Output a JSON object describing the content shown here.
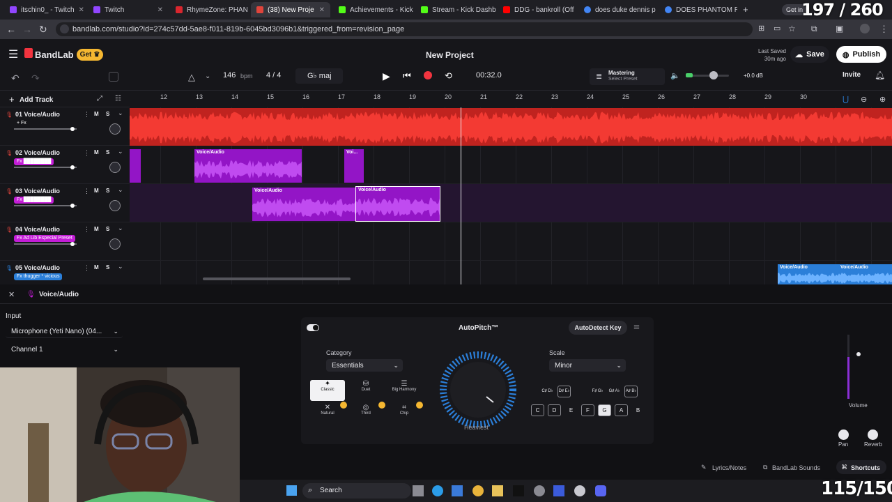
{
  "browser": {
    "tabs": [
      {
        "label": "itschin0_ - Twitch",
        "color": "#9146ff"
      },
      {
        "label": "Twitch",
        "color": "#9146ff"
      },
      {
        "label": "RhymeZone: PHAN",
        "color": "#d9262e"
      },
      {
        "label": "(38) New Proje",
        "color": "#e0443b"
      },
      {
        "label": "Achievements - Kick",
        "color": "#53fc18"
      },
      {
        "label": "Stream - Kick Dashb",
        "color": "#53fc18"
      },
      {
        "label": "DDG - bankroll (Off",
        "color": "#ff0000"
      },
      {
        "label": "does duke dennis p",
        "color": "#4285f4"
      },
      {
        "label": "DOES PHANTOM R",
        "color": "#4285f4"
      }
    ],
    "new_tab": "+",
    "getin_label": "Get in",
    "url": "bandlab.com/studio?id=274c57dd-5ae8-f011-819b-6045bd3096b1&triggered_from=revision_page"
  },
  "overlay": {
    "top_counter": "197 / 260",
    "bottom_counter": "115/150"
  },
  "app": {
    "brand": "BandLab",
    "get_label": "Get",
    "project_title": "New Project",
    "last_saved_label": "Last Saved",
    "last_saved_time": "30m ago",
    "save_label": "Save",
    "publish_label": "Publish",
    "invite_label": "Invite"
  },
  "transport": {
    "bpm": "146",
    "bpm_unit": "bpm",
    "time_sig": "4 / 4",
    "key": "G♭ maj",
    "time": "00:32.0",
    "mastering_label": "Mastering",
    "mastering_preset": "Select Preset",
    "db": "+0.0 dB"
  },
  "add_track_label": "Add Track",
  "ruler": [
    "12",
    "13",
    "14",
    "15",
    "16",
    "17",
    "18",
    "19",
    "20",
    "21",
    "22",
    "23",
    "24",
    "25",
    "26",
    "27",
    "28",
    "29",
    "30"
  ],
  "tracks": [
    {
      "name": "01  Voice/Audio",
      "fx": "+ Fx",
      "fx_color": "#16161a"
    },
    {
      "name": "02  Voice/Audio",
      "fx": "Fx  ████████",
      "fx_color": "#c31cd6"
    },
    {
      "name": "03  Voice/Audio",
      "fx": "Fx  ████████",
      "fx_color": "#c31cd6"
    },
    {
      "name": "04  Voice/Audio",
      "fx": "Fx  Ad Lib Especial Preset",
      "fx_color": "#c31cd6"
    },
    {
      "name": "05  Voice/Audio",
      "fx": "Fx  thugger * vicious",
      "fx_color": "#2b7fd9"
    }
  ],
  "track_buttons": {
    "m": "M",
    "s": "S"
  },
  "clip_label": "Voice/Audio",
  "clip_label_short": "Voi...",
  "panel": {
    "title": "Voice/Audio",
    "input_label": "Input",
    "input_device": "Microphone (Yeti Nano) (04...",
    "channel": "Channel 1"
  },
  "autopitch": {
    "title": "AutoPitch™",
    "autodetect_label": "AutoDetect Key",
    "category_label": "Category",
    "category_value": "Essentials",
    "scale_label": "Scale",
    "scale_value": "Minor",
    "dial_label": "Heaviest",
    "styles": [
      "Classic",
      "Duet",
      "Big Harmony",
      "Natural",
      "Third",
      "Chip"
    ],
    "sharp_keys": [
      "C♯ D♭",
      "D♯ E♭",
      "F♯ G♭",
      "G♯ A♭",
      "A♯ B♭"
    ],
    "natural_keys": [
      "C",
      "D",
      "E",
      "F",
      "G",
      "A",
      "B"
    ]
  },
  "mixer": {
    "volume_label": "Volume",
    "pan_label": "Pan",
    "reverb_label": "Reverb"
  },
  "footer": {
    "lyrics_label": "Lyrics/Notes",
    "sounds_label": "BandLab Sounds",
    "shortcuts_label": "Shortcuts"
  },
  "taskbar": {
    "search_label": "Search"
  }
}
